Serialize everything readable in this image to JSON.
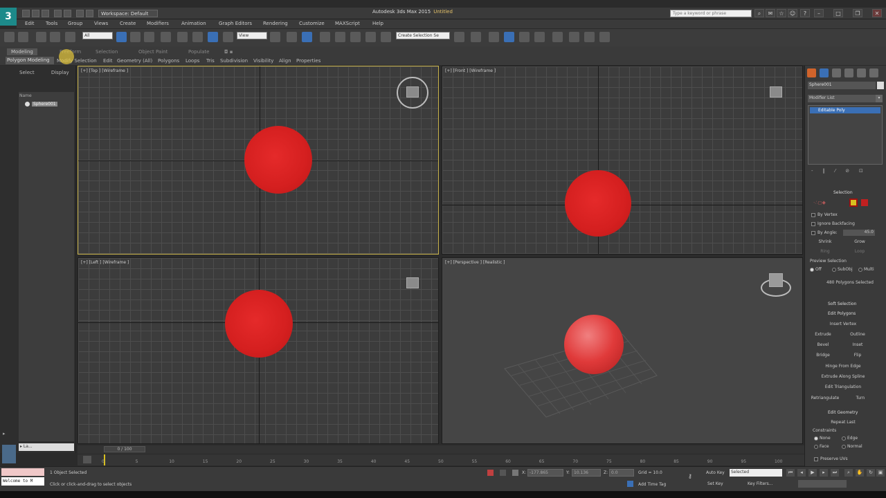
{
  "app": {
    "logo": "3",
    "workspace": "Workspace: Default",
    "title": "Autodesk 3ds Max 2015",
    "document": "Untitled",
    "search_placeholder": "Type a keyword or phrase"
  },
  "menus": [
    "Edit",
    "Tools",
    "Group",
    "Views",
    "Create",
    "Modifiers",
    "Animation",
    "Graph Editors",
    "Rendering",
    "Customize",
    "MAXScript",
    "Help"
  ],
  "toolbar": {
    "filter": "All",
    "ref_coord": "View",
    "named_sel": "Create Selection Se"
  },
  "ribbon": {
    "tabs": [
      "Modeling",
      "Freeform",
      "Selection",
      "Object Paint",
      "Populate"
    ],
    "subtabs": [
      "Polygon Modeling",
      "Modify Selection",
      "Edit",
      "Geometry (All)",
      "Polygons",
      "Loops",
      "Tris",
      "Subdivision",
      "Visibility",
      "Align",
      "Properties"
    ]
  },
  "scene_explorer": {
    "tabs": [
      "Select",
      "Display"
    ],
    "column_header": "Name",
    "object": "Sphere001",
    "bottom_field": "▸ La..."
  },
  "viewports": {
    "top": "[+] [Top ] [Wireframe ]",
    "front": "[+] [Front ] [Wireframe ]",
    "left": "[+] [Left ] [Wireframe ]",
    "perspective": "[+] [Perspective ] [Realistic ]"
  },
  "command_panel": {
    "object_name": "Sphere001",
    "modifier_list": "Modifier List",
    "stack_item": "Editable Poly",
    "selection_header": "Selection",
    "by_vertex": "By Vertex",
    "ignore_backfacing": "Ignore Backfacing",
    "by_angle": "By Angle:",
    "by_angle_value": "45.0",
    "shrink": "Shrink",
    "grow": "Grow",
    "ring": "Ring",
    "loop": "Loop",
    "preview_selection": "Preview Selection",
    "preview_opts": [
      "Off",
      "SubObj",
      "Multi"
    ],
    "selected_count": "480 Polygons Selected",
    "soft_selection": "Soft Selection",
    "edit_polygons": "Edit Polygons",
    "insert_vertex": "Insert Vertex",
    "extrude": "Extrude",
    "outline": "Outline",
    "bevel": "Bevel",
    "inset": "Inset",
    "bridge": "Bridge",
    "flip": "Flip",
    "hinge": "Hinge From Edge",
    "extrude_spline": "Extrude Along Spline",
    "edit_triangulation": "Edit Triangulation",
    "retriangulate": "Retriangulate",
    "turn": "Turn",
    "edit_geometry": "Edit Geometry",
    "repeat_last": "Repeat Last",
    "constraints": "Constraints",
    "constraint_opts": [
      "None",
      "Edge",
      "Face",
      "Normal"
    ],
    "preserve_uvs": "Preserve UVs"
  },
  "timeline": {
    "slider": "0 / 100",
    "ticks": [
      "0",
      "5",
      "10",
      "15",
      "20",
      "25",
      "30",
      "35",
      "40",
      "45",
      "50",
      "55",
      "60",
      "65",
      "70",
      "75",
      "80",
      "85",
      "90",
      "95",
      "100"
    ]
  },
  "status": {
    "maxscript": "Welcome to M",
    "line1": "1 Object Selected",
    "line2": "Click or click-and-drag to select objects",
    "x": "-177.865",
    "y": "10.136",
    "z": "0.0",
    "grid": "Grid = 10.0",
    "add_time_tag": "Add Time Tag",
    "auto_key": "Auto Key",
    "set_key": "Set Key",
    "selected": "Selected",
    "key_filters": "Key Filters..."
  },
  "colors": {
    "sphere": "#d41f1f",
    "active_viewport": "#c8b24a",
    "stack_highlight": "#3a6fb5"
  }
}
